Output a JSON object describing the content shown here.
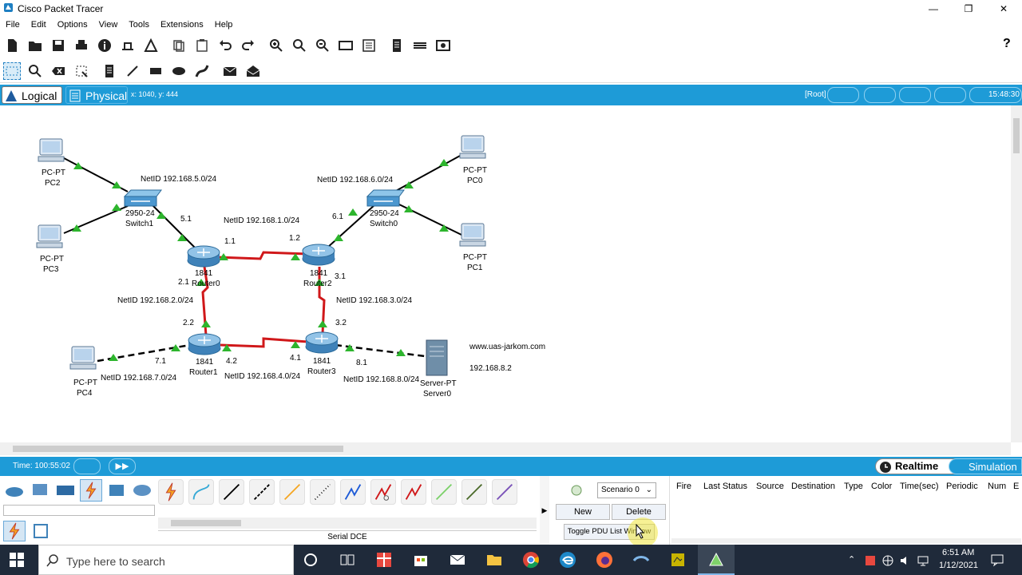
{
  "window": {
    "title": "Cisco Packet Tracer",
    "minimize": "—",
    "restore": "❐",
    "close": "✕"
  },
  "menu": [
    "File",
    "Edit",
    "Options",
    "View",
    "Tools",
    "Extensions",
    "Help"
  ],
  "help_icon": "?",
  "tabs": {
    "logical": "Logical",
    "physical": "Physical"
  },
  "cursor_coords": "x: 1040, y: 444",
  "root_label": "[Root]",
  "clock_short": "15:48:30",
  "topology": {
    "devices": {
      "pc2": [
        "PC-PT",
        "PC2"
      ],
      "pc3": [
        "PC-PT",
        "PC3"
      ],
      "pc0": [
        "PC-PT",
        "PC0"
      ],
      "pc1": [
        "PC-PT",
        "PC1"
      ],
      "pc4": [
        "PC-PT",
        "PC4"
      ],
      "switch1": [
        "2950-24",
        "Switch1"
      ],
      "switch0": [
        "2950-24",
        "Switch0"
      ],
      "router0": [
        "1841",
        "Router0"
      ],
      "router2": [
        "1841",
        "Router2"
      ],
      "router1": [
        "1841",
        "Router1"
      ],
      "router3": [
        "1841",
        "Router3"
      ],
      "server0": [
        "Server-PT",
        "Server0"
      ]
    },
    "nets": {
      "n5": "NetID 192.168.5.0/24",
      "n6": "NetID 192.168.6.0/24",
      "n1": "NetID 192.168.1.0/24",
      "n2": "NetID 192.168.2.0/24",
      "n3": "NetID 192.168.3.0/24",
      "n7": "NetID 192.168.7.0/24",
      "n4": "NetID 192.168.4.0/24",
      "n8": "NetID 192.168.8.0/24"
    },
    "ifaces": {
      "i51": "5.1",
      "i61": "6.1",
      "i11": "1.1",
      "i12": "1.2",
      "i21": "2.1",
      "i31": "3.1",
      "i22": "2.2",
      "i32": "3.2",
      "i71": "7.1",
      "i42": "4.2",
      "i41": "4.1",
      "i81": "8.1"
    },
    "server_url": "www.uas-jarkom.com",
    "server_ip": "192.168.8.2"
  },
  "sim": {
    "time": "Time: 100:55:02",
    "realtime": "Realtime",
    "simulation": "Simulation"
  },
  "connection_label": "Serial DCE",
  "pdu": {
    "scenario": "Scenario 0",
    "new": "New",
    "delete": "Delete",
    "toggle": "Toggle PDU List Window",
    "columns": [
      "Fire",
      "Last Status",
      "Source",
      "Destination",
      "Type",
      "Color",
      "Time(sec)",
      "Periodic",
      "Num",
      "E"
    ]
  },
  "taskbar": {
    "search_placeholder": "Type here to search",
    "time": "6:51 AM",
    "date": "1/12/2021"
  },
  "colors": {
    "accent": "#1e9bd7",
    "link_serial": "#d0181a",
    "link_up": "#2db52d"
  }
}
